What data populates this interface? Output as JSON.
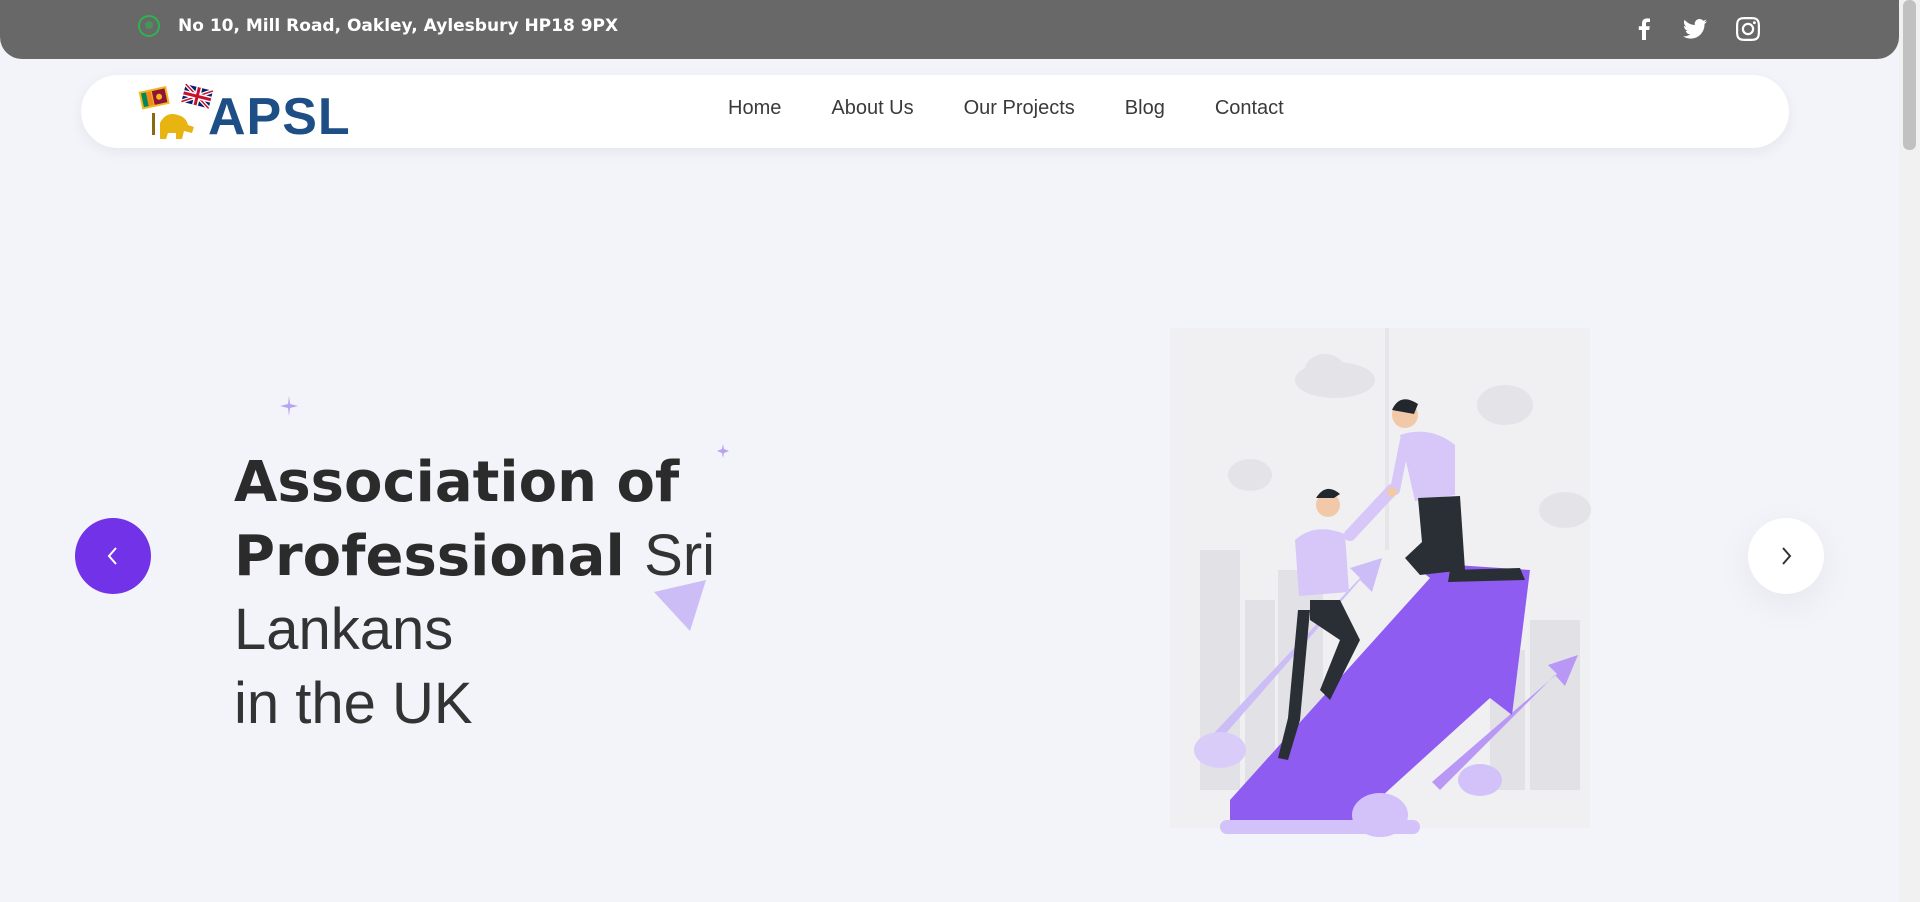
{
  "topbar": {
    "address": "No 10, Mill Road, Oakley, Aylesbury HP18 9PX",
    "address_icon": "map-pin-icon",
    "social": [
      "facebook-icon",
      "twitter-icon",
      "instagram-icon"
    ]
  },
  "brand": {
    "name": "APSL",
    "color": "#1d4e86"
  },
  "nav": {
    "items": [
      {
        "label": "Home"
      },
      {
        "label": "About Us"
      },
      {
        "label": "Our Projects"
      },
      {
        "label": "Blog"
      },
      {
        "label": "Contact"
      }
    ]
  },
  "hero": {
    "title_bold_1": "Association of",
    "title_bold_2": "Professional",
    "title_light_1": "Sri Lankans",
    "title_light_2": "in the UK"
  },
  "slider": {
    "prev_icon": "chevron-left-icon",
    "next_icon": "chevron-right-icon"
  },
  "colors": {
    "accent": "#7232e8",
    "topbar": "#686868",
    "background": "#f3f3fa",
    "illustration_purple": "#8f5cf2",
    "illustration_lilac": "#d3c1fa"
  }
}
